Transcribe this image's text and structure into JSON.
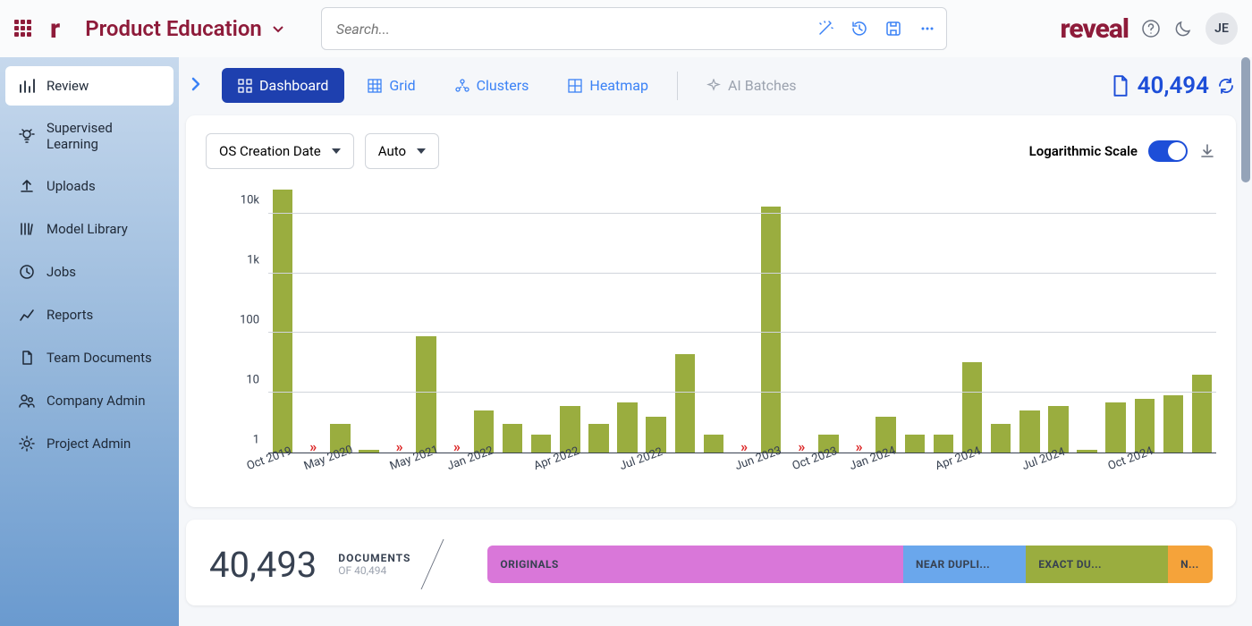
{
  "header": {
    "workspace": "Product Education",
    "search_placeholder": "Search...",
    "brand": "reveal",
    "avatar_initials": "JE"
  },
  "sidebar": {
    "items": [
      {
        "label": "Review"
      },
      {
        "label": "Supervised Learning"
      },
      {
        "label": "Uploads"
      },
      {
        "label": "Model Library"
      },
      {
        "label": "Jobs"
      },
      {
        "label": "Reports"
      },
      {
        "label": "Team Documents"
      },
      {
        "label": "Company Admin"
      },
      {
        "label": "Project Admin"
      }
    ]
  },
  "tabs": {
    "items": [
      {
        "label": "Dashboard"
      },
      {
        "label": "Grid"
      },
      {
        "label": "Clusters"
      },
      {
        "label": "Heatmap"
      },
      {
        "label": "AI Batches"
      }
    ],
    "doc_count": "40,494"
  },
  "chart": {
    "field_selector": "OS Creation Date",
    "interval_selector": "Auto",
    "log_label": "Logarithmic Scale",
    "y_ticks": [
      "1",
      "10",
      "100",
      "1k",
      "10k"
    ]
  },
  "chart_data": {
    "type": "bar",
    "yscale": "log",
    "ylim": [
      1,
      30000
    ],
    "xlabel": "",
    "ylabel": "",
    "categories": [
      "Oct 2019",
      "gap",
      "May 2020",
      "Jun 2020",
      "gap",
      "May 2021",
      "gap",
      "Jan 2022",
      "Feb 2022",
      "Mar 2022",
      "Apr 2022",
      "May 2022",
      "Jun 2022",
      "Jul 2022",
      "Aug 2022",
      "Sep 2022",
      "gap",
      "Jun 2023",
      "gap",
      "Oct 2023",
      "gap",
      "Jan 2024",
      "Feb 2024",
      "Mar 2024",
      "Apr 2024",
      "May 2024",
      "Jun 2024",
      "Jul 2024",
      "Aug 2024",
      "Sep 2024",
      "Oct 2024",
      "Nov 2024",
      "Dec 2024"
    ],
    "values": [
      25000,
      null,
      3,
      1.1,
      null,
      90,
      null,
      5,
      3,
      2,
      6,
      3,
      7,
      4,
      45,
      2,
      null,
      13000,
      null,
      2,
      null,
      4,
      2,
      2,
      32,
      3,
      5,
      6,
      1.1,
      7,
      8,
      9,
      20
    ],
    "x_ticks_shown": [
      "Oct 2019",
      "May 2020",
      "May 2021",
      "Jan 2022",
      "Apr 2022",
      "Jul 2022",
      "Jun 2023",
      "Oct 2023",
      "Jan 2024",
      "Apr 2024",
      "Jul 2024",
      "Oct 2024"
    ]
  },
  "summary": {
    "count": "40,493",
    "label": "DOCUMENTS",
    "sub": "OF 40,494",
    "segments": [
      {
        "label": "ORIGINALS",
        "color": "#d977d9",
        "flex": 60
      },
      {
        "label": "NEAR DUPLI...",
        "color": "#6aa7ec",
        "flex": 15
      },
      {
        "label": "EXACT DU...",
        "color": "#9aad3f",
        "flex": 18
      },
      {
        "label": "N...",
        "color": "#f5a33a",
        "flex": 3
      }
    ]
  }
}
